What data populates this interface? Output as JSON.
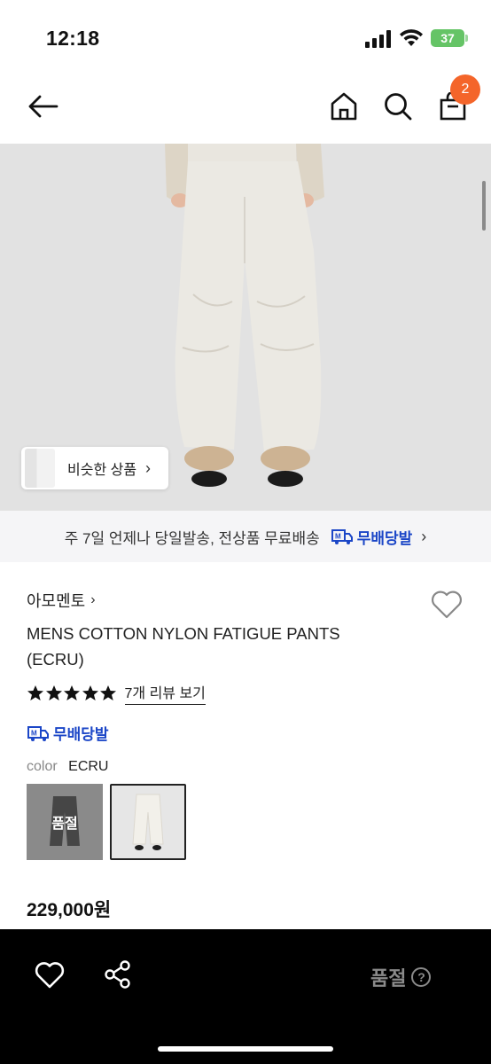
{
  "status_bar": {
    "time": "12:18",
    "battery": "37"
  },
  "nav": {
    "icons": [
      "arrow-left-icon",
      "home-icon",
      "search-icon",
      "shopping-bag-icon"
    ],
    "cart_count": "2"
  },
  "product_image": {
    "similar_button_label": "비슷한 상품",
    "similar_button_chevron": "›"
  },
  "shipping_banner": {
    "text": "주 7일 언제나 당일발송, 전상품 무료배송",
    "logo_label": "무배당발",
    "chevron": "›"
  },
  "product": {
    "brand": "아모멘토",
    "brand_chevron": "›",
    "title": "MENS COTTON NYLON FATIGUE PANTS (ECRU)",
    "rating_stars": 5,
    "review_link": "7개 리뷰 보기",
    "free_ship_label": "무배당발",
    "color_label": "color",
    "color_value": "ECRU",
    "swatches": [
      {
        "color": "black",
        "overlay": "품절"
      },
      {
        "color": "ecru",
        "selected": true
      }
    ],
    "price": "229,000원"
  },
  "bottom_bar": {
    "icons": [
      "heart-icon",
      "share-icon",
      "help-icon"
    ],
    "soldout_label": "품절",
    "help_glyph": "?"
  },
  "colors": {
    "accent_orange": "#f4652a",
    "brand_blue": "#1b46c7",
    "battery_green": "#65c466",
    "bottom_bar_bg": "#000000"
  }
}
